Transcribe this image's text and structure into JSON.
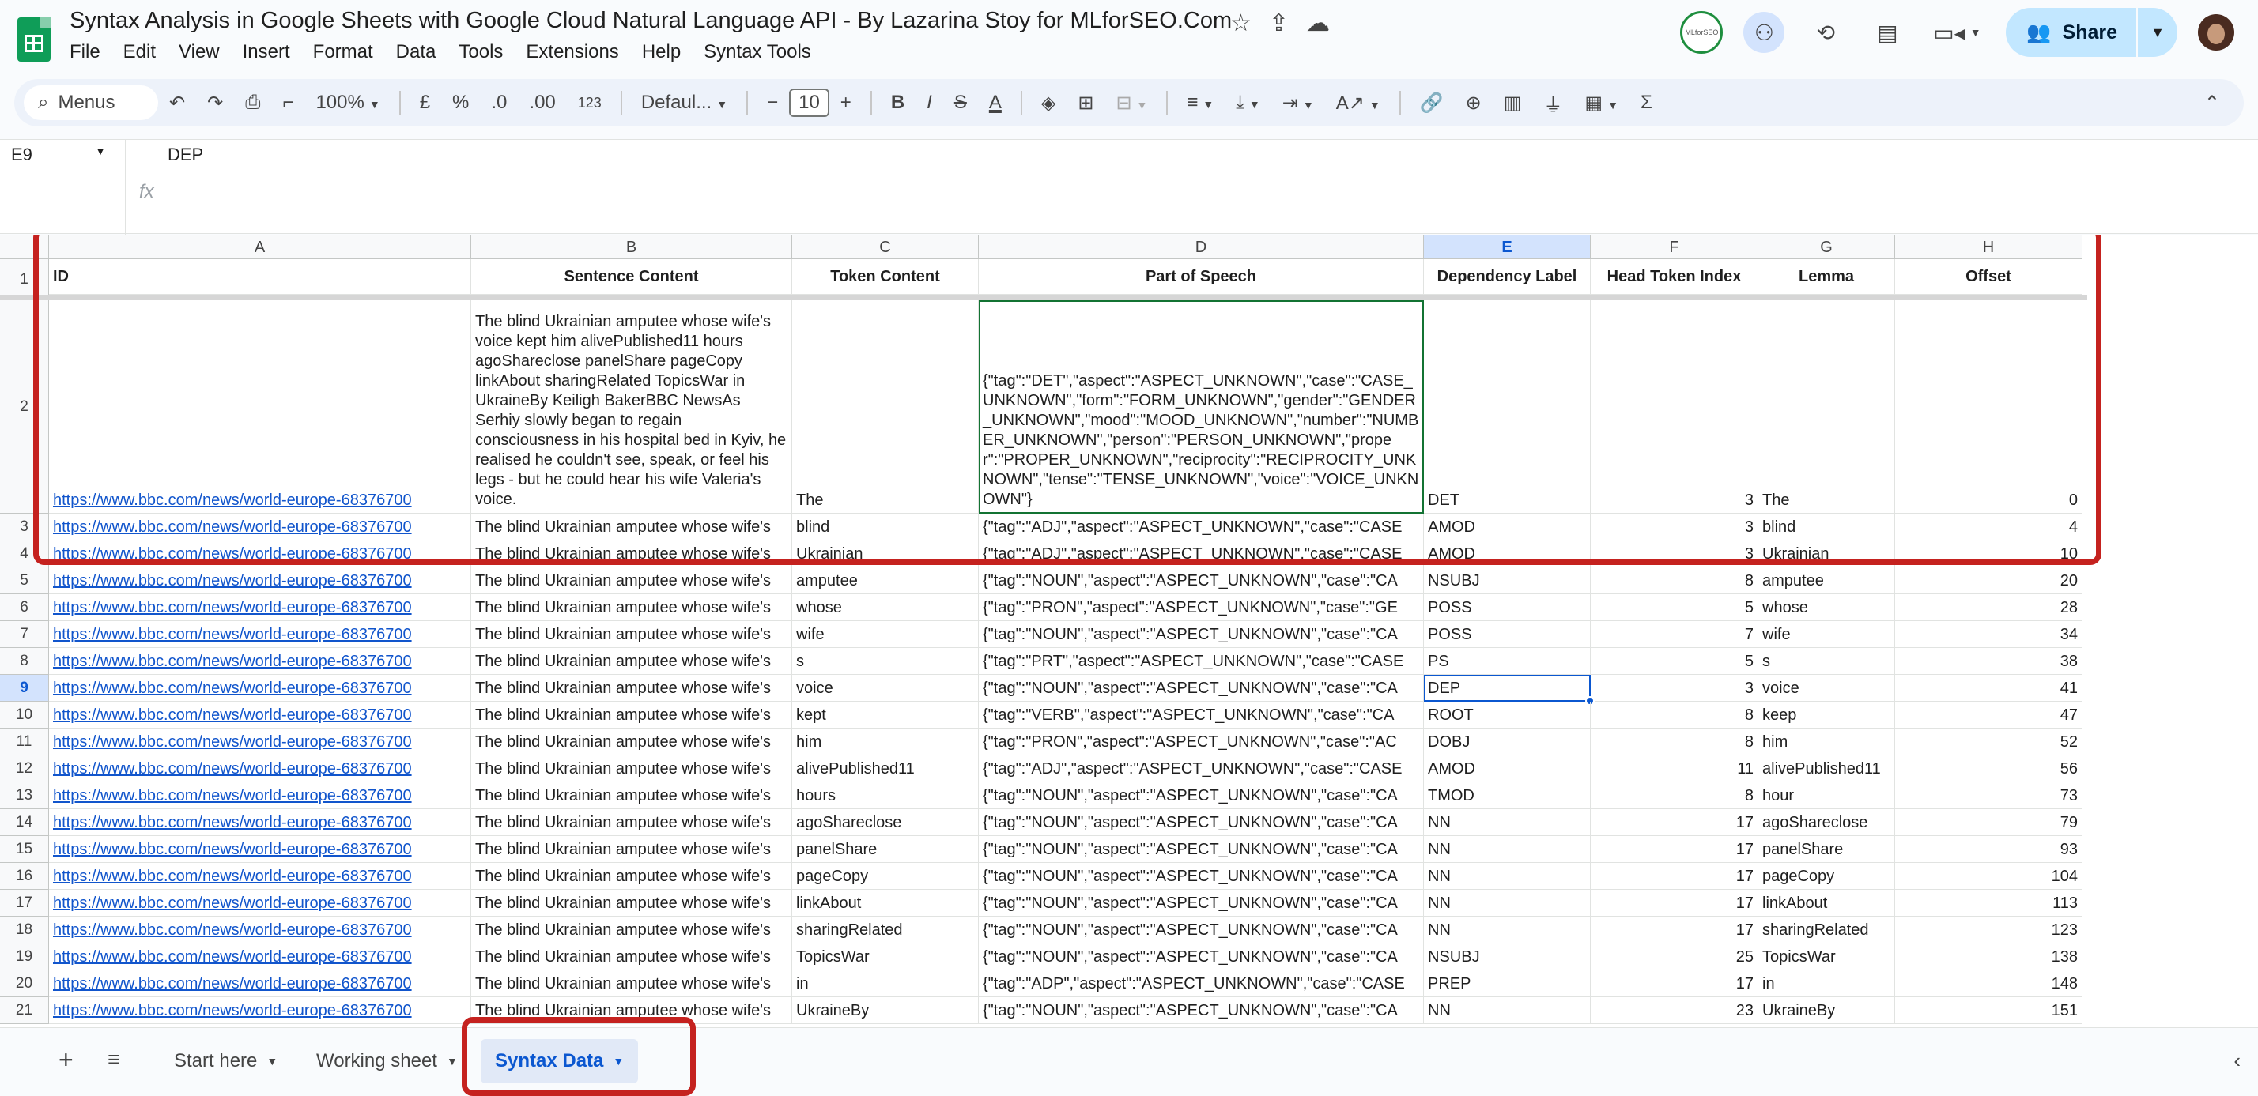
{
  "title": "Syntax Analysis in Google Sheets with Google Cloud Natural Language API - By Lazarina Stoy for MLforSEO.Com",
  "menu": [
    "File",
    "Edit",
    "View",
    "Insert",
    "Format",
    "Data",
    "Tools",
    "Extensions",
    "Help",
    "Syntax Tools"
  ],
  "share_label": "Share",
  "avatar_text": "MLforSEO",
  "toolbar": {
    "search_label": "Menus",
    "zoom": "100%",
    "currency": "£",
    "percent": "%",
    "dec_decrease": ".0",
    "dec_increase": ".00",
    "number_format": "123",
    "font": "Defaul...",
    "font_size": "10"
  },
  "name_box": "E9",
  "formula_value": "DEP",
  "columns": [
    "A",
    "B",
    "C",
    "D",
    "E",
    "F",
    "G",
    "H"
  ],
  "selected_column": "E",
  "headers": [
    "ID",
    "Sentence Content",
    "Token Content",
    "Part of Speech",
    "Dependency Label",
    "Head Token Index",
    "Lemma",
    "Offset"
  ],
  "row2": {
    "id": "https://www.bbc.com/news/world-europe-68376700",
    "sentence": "The blind Ukrainian amputee whose wife's voice kept him alivePublished11 hours agoShareclose panelShare pageCopy linkAbout sharingRelated TopicsWar in UkraineBy Keiligh BakerBBC NewsAs Serhiy slowly began to regain consciousness in his hospital bed in Kyiv, he realised he couldn't see, speak, or feel his legs - but he could hear his wife Valeria's voice.",
    "token": "The",
    "pos": "{\"tag\":\"DET\",\"aspect\":\"ASPECT_UNKNOWN\",\"case\":\"CASE_UNKNOWN\",\"form\":\"FORM_UNKNOWN\",\"gender\":\"GENDER_UNKNOWN\",\"mood\":\"MOOD_UNKNOWN\",\"number\":\"NUMBER_UNKNOWN\",\"person\":\"PERSON_UNKNOWN\",\"proper\":\"PROPER_UNKNOWN\",\"reciprocity\":\"RECIPROCITY_UNKNOWN\",\"tense\":\"TENSE_UNKNOWN\",\"voice\":\"VOICE_UNKNOWN\"}",
    "dep": "DET",
    "head": "3",
    "lemma": "The",
    "offset": "0"
  },
  "rows": [
    {
      "n": "3",
      "id": "https://www.bbc.com/news/world-europe-68376700",
      "sentence": "The blind Ukrainian amputee whose wife's",
      "token": "blind",
      "pos": "{\"tag\":\"ADJ\",\"aspect\":\"ASPECT_UNKNOWN\",\"case\":\"CASE",
      "dep": "AMOD",
      "head": "3",
      "lemma": "blind",
      "offset": "4"
    },
    {
      "n": "4",
      "id": "https://www.bbc.com/news/world-europe-68376700",
      "sentence": "The blind Ukrainian amputee whose wife's",
      "token": "Ukrainian",
      "pos": "{\"tag\":\"ADJ\",\"aspect\":\"ASPECT_UNKNOWN\",\"case\":\"CASE",
      "dep": "AMOD",
      "head": "3",
      "lemma": "Ukrainian",
      "offset": "10"
    },
    {
      "n": "5",
      "id": "https://www.bbc.com/news/world-europe-68376700",
      "sentence": "The blind Ukrainian amputee whose wife's",
      "token": "amputee",
      "pos": "{\"tag\":\"NOUN\",\"aspect\":\"ASPECT_UNKNOWN\",\"case\":\"CA",
      "dep": "NSUBJ",
      "head": "8",
      "lemma": "amputee",
      "offset": "20"
    },
    {
      "n": "6",
      "id": "https://www.bbc.com/news/world-europe-68376700",
      "sentence": "The blind Ukrainian amputee whose wife's",
      "token": "whose",
      "pos": "{\"tag\":\"PRON\",\"aspect\":\"ASPECT_UNKNOWN\",\"case\":\"GE",
      "dep": "POSS",
      "head": "5",
      "lemma": "whose",
      "offset": "28"
    },
    {
      "n": "7",
      "id": "https://www.bbc.com/news/world-europe-68376700",
      "sentence": "The blind Ukrainian amputee whose wife's",
      "token": "wife",
      "pos": "{\"tag\":\"NOUN\",\"aspect\":\"ASPECT_UNKNOWN\",\"case\":\"CA",
      "dep": "POSS",
      "head": "7",
      "lemma": "wife",
      "offset": "34"
    },
    {
      "n": "8",
      "id": "https://www.bbc.com/news/world-europe-68376700",
      "sentence": "The blind Ukrainian amputee whose wife's",
      "token": "s",
      "pos": "{\"tag\":\"PRT\",\"aspect\":\"ASPECT_UNKNOWN\",\"case\":\"CASE",
      "dep": "PS",
      "head": "5",
      "lemma": "s",
      "offset": "38"
    },
    {
      "n": "9",
      "id": "https://www.bbc.com/news/world-europe-68376700",
      "sentence": "The blind Ukrainian amputee whose wife's",
      "token": "voice",
      "pos": "{\"tag\":\"NOUN\",\"aspect\":\"ASPECT_UNKNOWN\",\"case\":\"CA",
      "dep": "DEP",
      "head": "3",
      "lemma": "voice",
      "offset": "41"
    },
    {
      "n": "10",
      "id": "https://www.bbc.com/news/world-europe-68376700",
      "sentence": "The blind Ukrainian amputee whose wife's",
      "token": "kept",
      "pos": "{\"tag\":\"VERB\",\"aspect\":\"ASPECT_UNKNOWN\",\"case\":\"CA",
      "dep": "ROOT",
      "head": "8",
      "lemma": "keep",
      "offset": "47"
    },
    {
      "n": "11",
      "id": "https://www.bbc.com/news/world-europe-68376700",
      "sentence": "The blind Ukrainian amputee whose wife's",
      "token": "him",
      "pos": "{\"tag\":\"PRON\",\"aspect\":\"ASPECT_UNKNOWN\",\"case\":\"AC",
      "dep": "DOBJ",
      "head": "8",
      "lemma": "him",
      "offset": "52"
    },
    {
      "n": "12",
      "id": "https://www.bbc.com/news/world-europe-68376700",
      "sentence": "The blind Ukrainian amputee whose wife's",
      "token": "alivePublished11",
      "pos": "{\"tag\":\"ADJ\",\"aspect\":\"ASPECT_UNKNOWN\",\"case\":\"CASE",
      "dep": "AMOD",
      "head": "11",
      "lemma": "alivePublished11",
      "offset": "56"
    },
    {
      "n": "13",
      "id": "https://www.bbc.com/news/world-europe-68376700",
      "sentence": "The blind Ukrainian amputee whose wife's",
      "token": "hours",
      "pos": "{\"tag\":\"NOUN\",\"aspect\":\"ASPECT_UNKNOWN\",\"case\":\"CA",
      "dep": "TMOD",
      "head": "8",
      "lemma": "hour",
      "offset": "73"
    },
    {
      "n": "14",
      "id": "https://www.bbc.com/news/world-europe-68376700",
      "sentence": "The blind Ukrainian amputee whose wife's",
      "token": "agoShareclose",
      "pos": "{\"tag\":\"NOUN\",\"aspect\":\"ASPECT_UNKNOWN\",\"case\":\"CA",
      "dep": "NN",
      "head": "17",
      "lemma": "agoShareclose",
      "offset": "79"
    },
    {
      "n": "15",
      "id": "https://www.bbc.com/news/world-europe-68376700",
      "sentence": "The blind Ukrainian amputee whose wife's",
      "token": "panelShare",
      "pos": "{\"tag\":\"NOUN\",\"aspect\":\"ASPECT_UNKNOWN\",\"case\":\"CA",
      "dep": "NN",
      "head": "17",
      "lemma": "panelShare",
      "offset": "93"
    },
    {
      "n": "16",
      "id": "https://www.bbc.com/news/world-europe-68376700",
      "sentence": "The blind Ukrainian amputee whose wife's",
      "token": "pageCopy",
      "pos": "{\"tag\":\"NOUN\",\"aspect\":\"ASPECT_UNKNOWN\",\"case\":\"CA",
      "dep": "NN",
      "head": "17",
      "lemma": "pageCopy",
      "offset": "104"
    },
    {
      "n": "17",
      "id": "https://www.bbc.com/news/world-europe-68376700",
      "sentence": "The blind Ukrainian amputee whose wife's",
      "token": "linkAbout",
      "pos": "{\"tag\":\"NOUN\",\"aspect\":\"ASPECT_UNKNOWN\",\"case\":\"CA",
      "dep": "NN",
      "head": "17",
      "lemma": "linkAbout",
      "offset": "113"
    },
    {
      "n": "18",
      "id": "https://www.bbc.com/news/world-europe-68376700",
      "sentence": "The blind Ukrainian amputee whose wife's",
      "token": "sharingRelated",
      "pos": "{\"tag\":\"NOUN\",\"aspect\":\"ASPECT_UNKNOWN\",\"case\":\"CA",
      "dep": "NN",
      "head": "17",
      "lemma": "sharingRelated",
      "offset": "123"
    },
    {
      "n": "19",
      "id": "https://www.bbc.com/news/world-europe-68376700",
      "sentence": "The blind Ukrainian amputee whose wife's",
      "token": "TopicsWar",
      "pos": "{\"tag\":\"NOUN\",\"aspect\":\"ASPECT_UNKNOWN\",\"case\":\"CA",
      "dep": "NSUBJ",
      "head": "25",
      "lemma": "TopicsWar",
      "offset": "138"
    },
    {
      "n": "20",
      "id": "https://www.bbc.com/news/world-europe-68376700",
      "sentence": "The blind Ukrainian amputee whose wife's",
      "token": "in",
      "pos": "{\"tag\":\"ADP\",\"aspect\":\"ASPECT_UNKNOWN\",\"case\":\"CASE",
      "dep": "PREP",
      "head": "17",
      "lemma": "in",
      "offset": "148"
    },
    {
      "n": "21",
      "id": "https://www.bbc.com/news/world-europe-68376700",
      "sentence": "The blind Ukrainian amputee whose wife's",
      "token": "UkraineBy",
      "pos": "{\"tag\":\"NOUN\",\"aspect\":\"ASPECT_UNKNOWN\",\"case\":\"CA",
      "dep": "NN",
      "head": "23",
      "lemma": "UkraineBy",
      "offset": "151"
    }
  ],
  "tabs": [
    {
      "label": "Start here",
      "active": false
    },
    {
      "label": "Working sheet",
      "active": false
    },
    {
      "label": "Syntax Data",
      "active": true
    }
  ],
  "colors": {
    "highlight": "#c5221f",
    "selection": "#0b57d0",
    "link": "#1155cc",
    "share_bg": "#c2e7ff"
  }
}
